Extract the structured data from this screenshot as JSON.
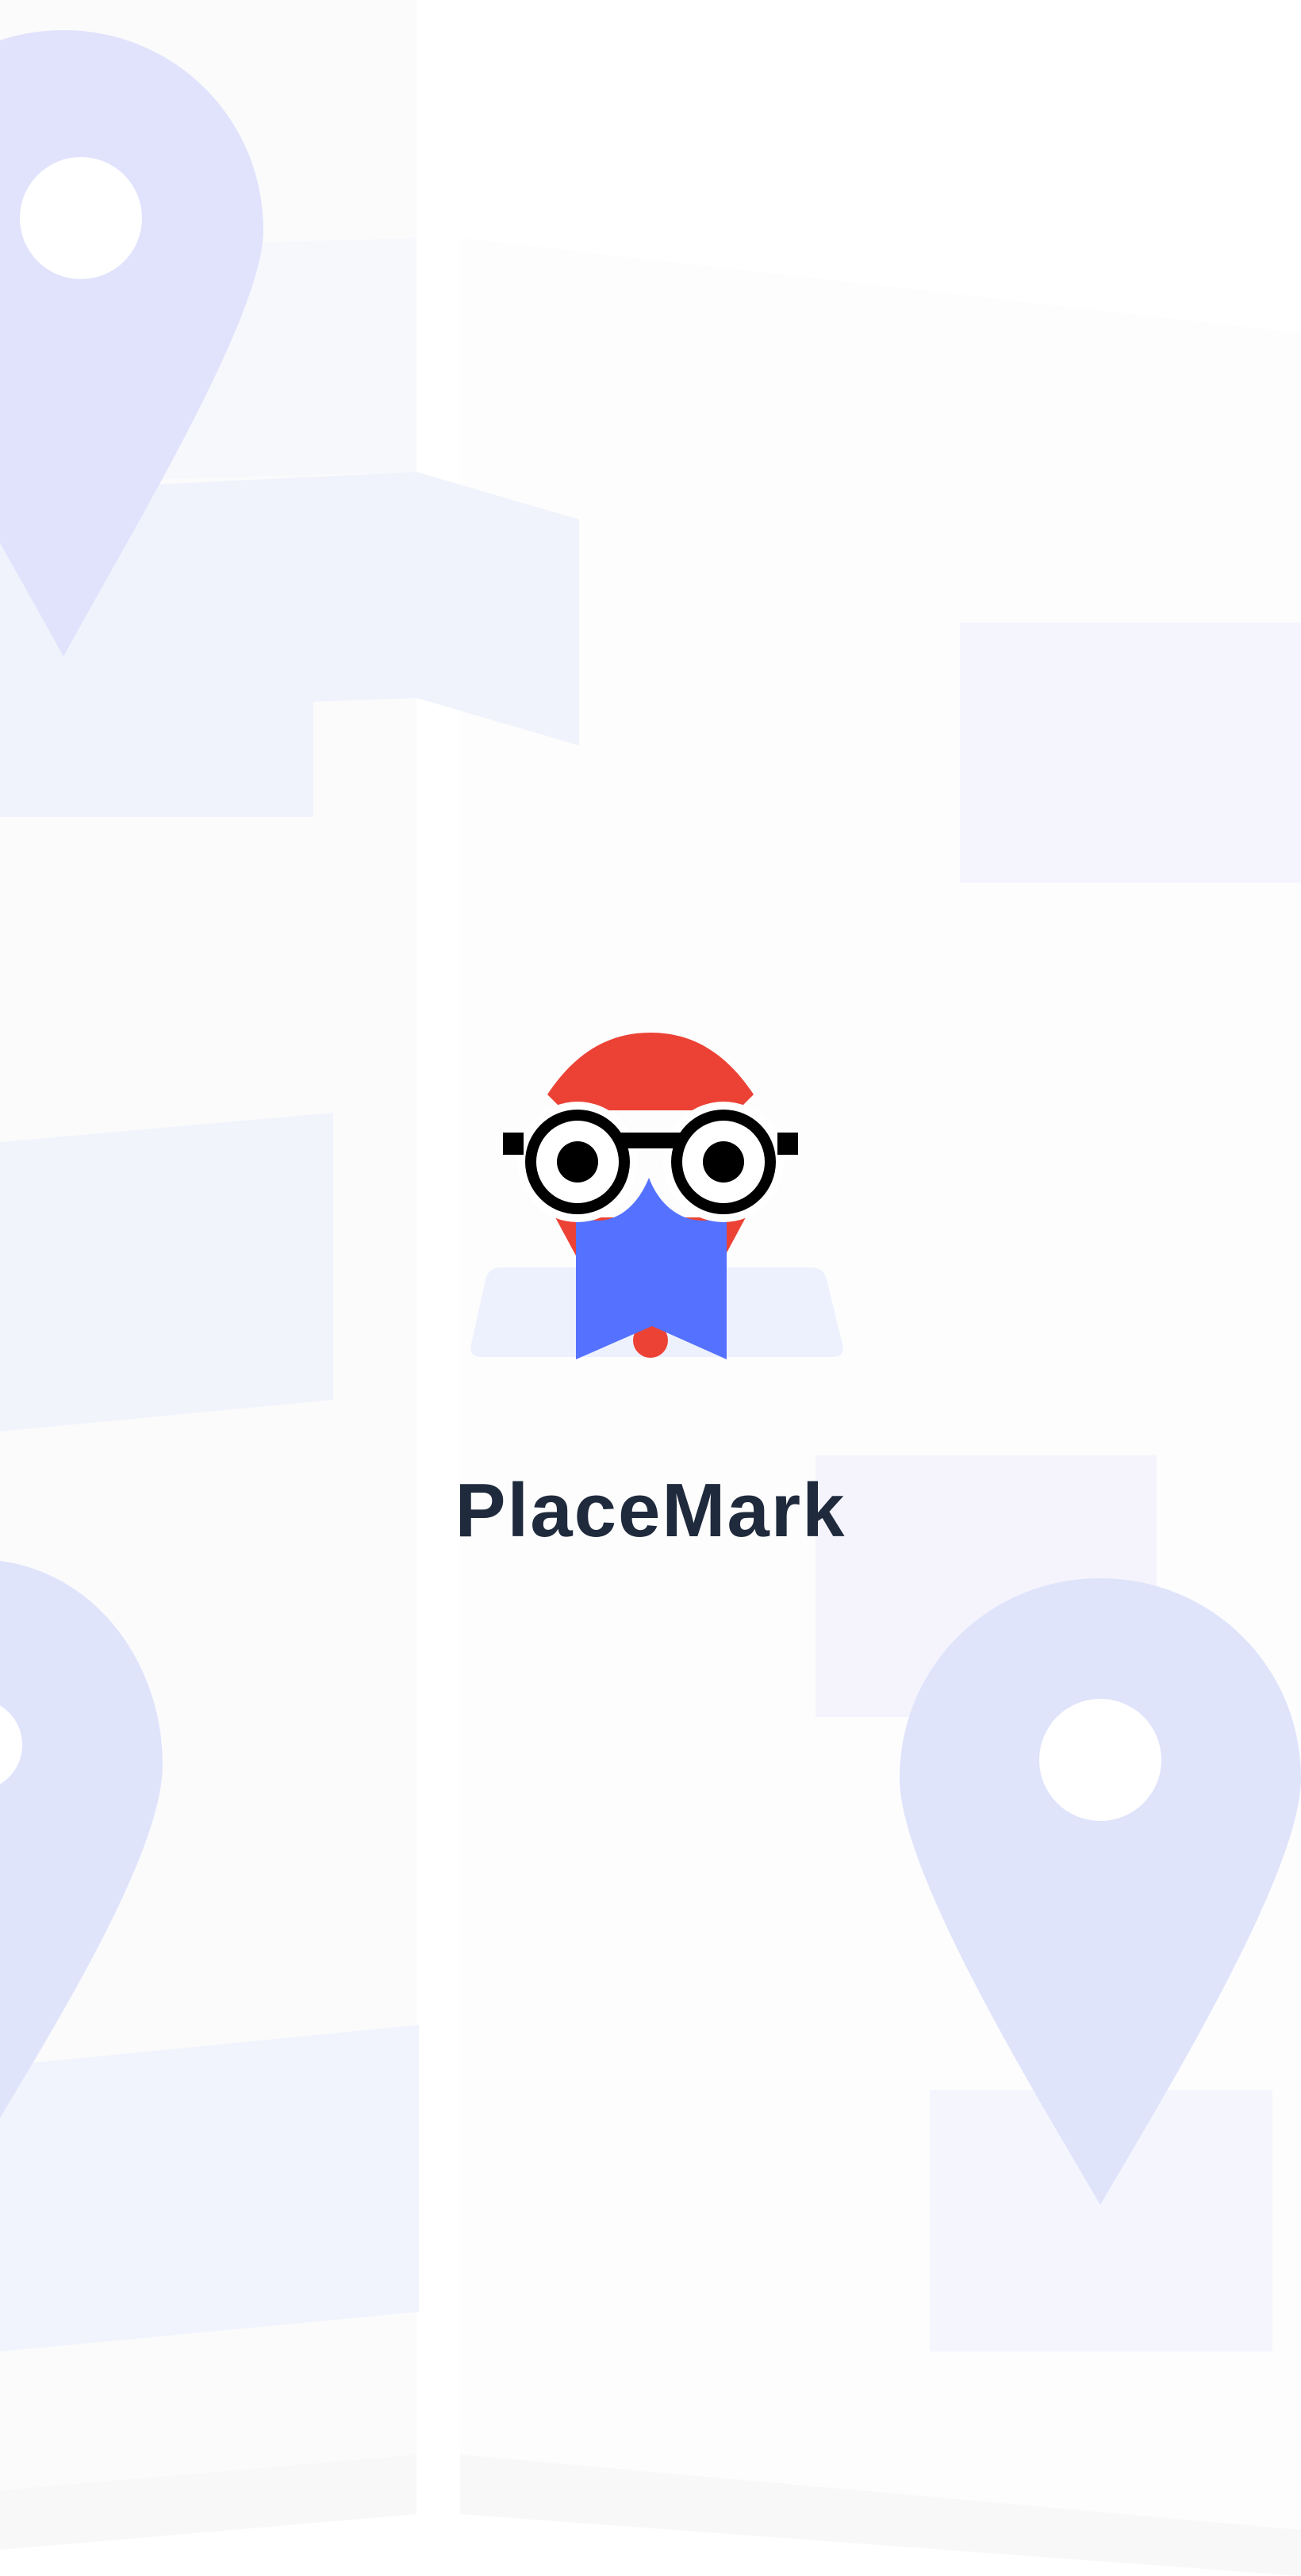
{
  "app": {
    "name": "PlaceMark"
  },
  "splash": {
    "logo_icon": "owl-bookmark-logo-icon",
    "background_icons": [
      "map-pin-icon",
      "map-pin-icon",
      "map-pin-icon"
    ]
  },
  "colors": {
    "background": "#ffffff",
    "map_block": "#f4f5fd",
    "map_shadow": "#f7f7f8",
    "pin": "#dfe3fb",
    "owl_head": "#ec4236",
    "owl_body": "#5472ff",
    "glasses": "#000000",
    "logo_base": "#edf1fd",
    "title_text": "#1f2a3c"
  }
}
